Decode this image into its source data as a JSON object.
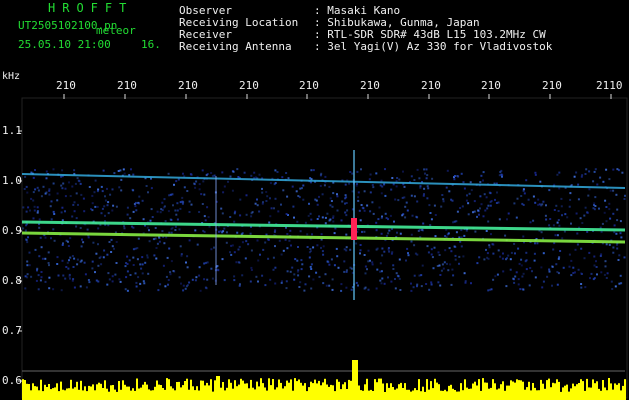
{
  "header": {
    "app_title": "HROFFT",
    "file_name": "UT2505102100.pn",
    "meteor_label": "meteor",
    "datetime": "25.05.10 21:00",
    "interval": "16."
  },
  "meta": {
    "observer_label": "Observer",
    "observer_value": ": Masaki Kano",
    "location_label": "Receiving Location",
    "location_value": ": Shibukawa, Gunma, Japan",
    "receiver_label": "Receiver",
    "receiver_value": ": RTL-SDR SDR# 43dB L15 103.2MHz CW",
    "antenna_label": "Receiving Antenna",
    "antenna_value": ": 3el Yagi(V) Az 330 for Vladivostok"
  },
  "axis": {
    "unit": "kHz",
    "x_ticks": [
      "210",
      "210",
      "210",
      "210",
      "210",
      "210",
      "210",
      "210",
      "210",
      "2110"
    ],
    "y_ticks": [
      "1.1",
      "1.0",
      "0.9",
      "0.8",
      "0.7",
      "0.6"
    ]
  },
  "colors": {
    "background": "#000000",
    "header_green": "#22dd33",
    "text": "#f0f0f0",
    "noise": "#2233aa",
    "signal_band": "#33dd88",
    "meteor_echo": "#ff2255",
    "spectrum_bars": "#ffff00"
  }
}
